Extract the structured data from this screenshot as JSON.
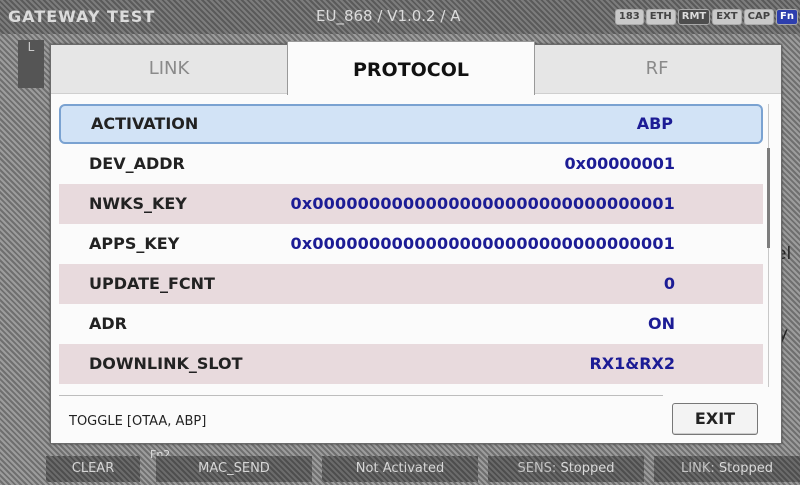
{
  "title_bar": {
    "app_name": "GATEWAY TEST",
    "version": "EU_868 / V1.0.2 / A",
    "badges": [
      "183",
      "ETH",
      "RMT",
      "EXT",
      "CAP",
      "Fn"
    ]
  },
  "left_tab": {
    "label": "L"
  },
  "tabs": [
    {
      "label": "LINK"
    },
    {
      "label": "PROTOCOL"
    },
    {
      "label": "RF"
    }
  ],
  "rows": [
    {
      "label": "ACTIVATION",
      "value": "ABP"
    },
    {
      "label": "DEV_ADDR",
      "value": "0x00000001"
    },
    {
      "label": "NWKS_KEY",
      "value": "0x00000000000000000000000000000001"
    },
    {
      "label": "APPS_KEY",
      "value": "0x00000000000000000000000000000001"
    },
    {
      "label": "UPDATE_FCNT",
      "value": "0"
    },
    {
      "label": "ADR",
      "value": "ON"
    },
    {
      "label": "DOWNLINK_SLOT",
      "value": "RX1&RX2"
    }
  ],
  "hint": "TOGGLE [OTAA, ABP]",
  "exit_label": "EXIT",
  "background_fragments": {
    "right_a": "el",
    "right_b": "y"
  },
  "softkeys": {
    "clear": "CLEAR",
    "fn_marker": "Fn2",
    "mac_send": "MAC_SEND",
    "activation_status": "Not Activated",
    "sens": {
      "key": "SENS:",
      "value": "Stopped"
    },
    "link": {
      "key": "LINK:",
      "value": "Stopped"
    }
  },
  "colors": {
    "value_text": "#1c1c95",
    "selected_row": "#d2e3f6",
    "alt_row": "#e8dadd",
    "fn_badge": "#2e3fae"
  }
}
